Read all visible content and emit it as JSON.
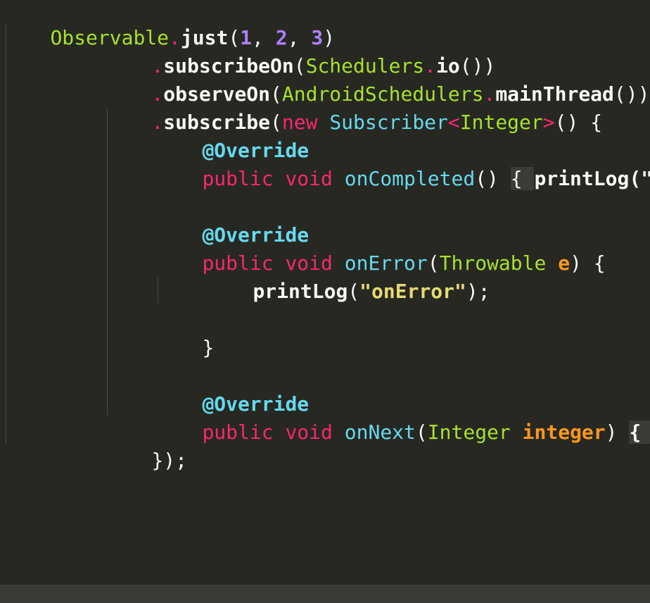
{
  "code": {
    "line1": {
      "t1": "Observable",
      "t2": ".",
      "t3": "just",
      "t4": "(",
      "t5": "1",
      "t6": ", ",
      "t7": "2",
      "t8": ", ",
      "t9": "3",
      "t10": ")"
    },
    "line2": {
      "t1": ".",
      "t2": "subscribeOn",
      "t3": "(",
      "t4": "Schedulers",
      "t5": ".",
      "t6": "io",
      "t7": "())"
    },
    "line3": {
      "t1": ".",
      "t2": "observeOn",
      "t3": "(",
      "t4": "AndroidSchedulers",
      "t5": ".",
      "t6": "mainThread",
      "t7": "())"
    },
    "line4": {
      "t1": ".",
      "t2": "subscribe",
      "t3": "(",
      "t4": "new",
      "t5": " ",
      "t6": "Subscriber",
      "t7": "<",
      "t8": "Integer",
      "t9": ">",
      "t10": "() {"
    },
    "line5": {
      "t1": "@Override"
    },
    "line6": {
      "t1": "public",
      "t2": " ",
      "t3": "void",
      "t4": " ",
      "t5": "onCompleted",
      "t6": "() ",
      "t7": "{ ",
      "t8": "printLog",
      "t9": "(\"Co"
    },
    "line8": {
      "t1": "@Override"
    },
    "line9": {
      "t1": "public",
      "t2": " ",
      "t3": "void",
      "t4": " ",
      "t5": "onError",
      "t6": "(",
      "t7": "Throwable",
      "t8": " ",
      "t9": "e",
      "t10": ") {"
    },
    "line10": {
      "t1": "printLog",
      "t2": "(",
      "t3": "\"onError\"",
      "t4": ");"
    },
    "line12": {
      "t1": "}"
    },
    "line14": {
      "t1": "@Override"
    },
    "line15": {
      "t1": "public",
      "t2": " ",
      "t3": "void",
      "t4": " ",
      "t5": "onNext",
      "t6": "(",
      "t7": "Integer",
      "t8": " ",
      "t9": "integer",
      "t10": ") ",
      "t11": "{ p"
    },
    "line16": {
      "t1": "});"
    }
  },
  "theme": {
    "background": "#272822",
    "type_color": "#a6e22e",
    "keyword_color": "#f92672",
    "entity_color": "#66d9ef",
    "number_color": "#ae81ff",
    "string_color": "#e6db74",
    "parameter_color": "#fd971f",
    "text_color": "#f8f8f2"
  }
}
